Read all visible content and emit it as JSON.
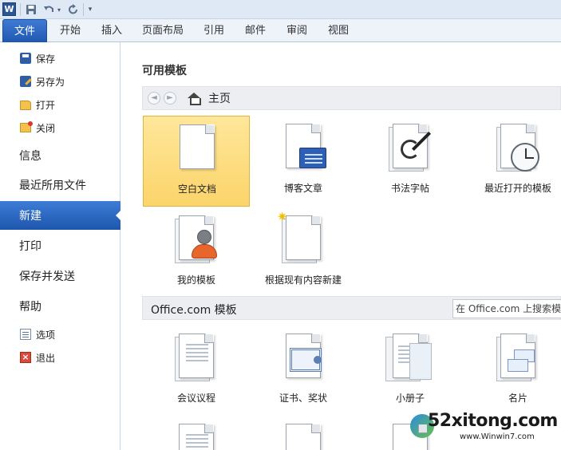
{
  "quick_access": {
    "logo": "W",
    "save_icon": "save-icon",
    "undo_icon": "undo-icon",
    "redo_icon": "redo-icon",
    "customize_icon": "customize-icon"
  },
  "ribbon": {
    "tabs": [
      {
        "label": "文件",
        "active": true
      },
      {
        "label": "开始"
      },
      {
        "label": "插入"
      },
      {
        "label": "页面布局"
      },
      {
        "label": "引用"
      },
      {
        "label": "邮件"
      },
      {
        "label": "审阅"
      },
      {
        "label": "视图"
      }
    ]
  },
  "nav": {
    "save": "保存",
    "save_as": "另存为",
    "open": "打开",
    "close": "关闭",
    "info": "信息",
    "recent": "最近所用文件",
    "new": "新建",
    "print": "打印",
    "save_send": "保存并发送",
    "help": "帮助",
    "options": "选项",
    "exit": "退出"
  },
  "main": {
    "section_title": "可用模板",
    "back_arrow": "◄",
    "forward_arrow": "►",
    "home_label": "主页",
    "templates": [
      {
        "label": "空白文档",
        "selected": true
      },
      {
        "label": "博客文章"
      },
      {
        "label": "书法字帖"
      },
      {
        "label": "最近打开的模板"
      },
      {
        "label": "我的模板"
      },
      {
        "label": "根据现有内容新建"
      }
    ],
    "office": {
      "title": "Office.com 模板",
      "search_placeholder": "在 Office.com 上搜索模",
      "items": [
        {
          "label": "会议议程"
        },
        {
          "label": "证书、奖状"
        },
        {
          "label": "小册子"
        },
        {
          "label": "名片"
        }
      ]
    }
  },
  "watermark": {
    "text": "52xitong.com",
    "url": "www.Winwin7.com"
  },
  "colors": {
    "accent": "#1f58b0",
    "selected_tile": "#fbd46a"
  }
}
